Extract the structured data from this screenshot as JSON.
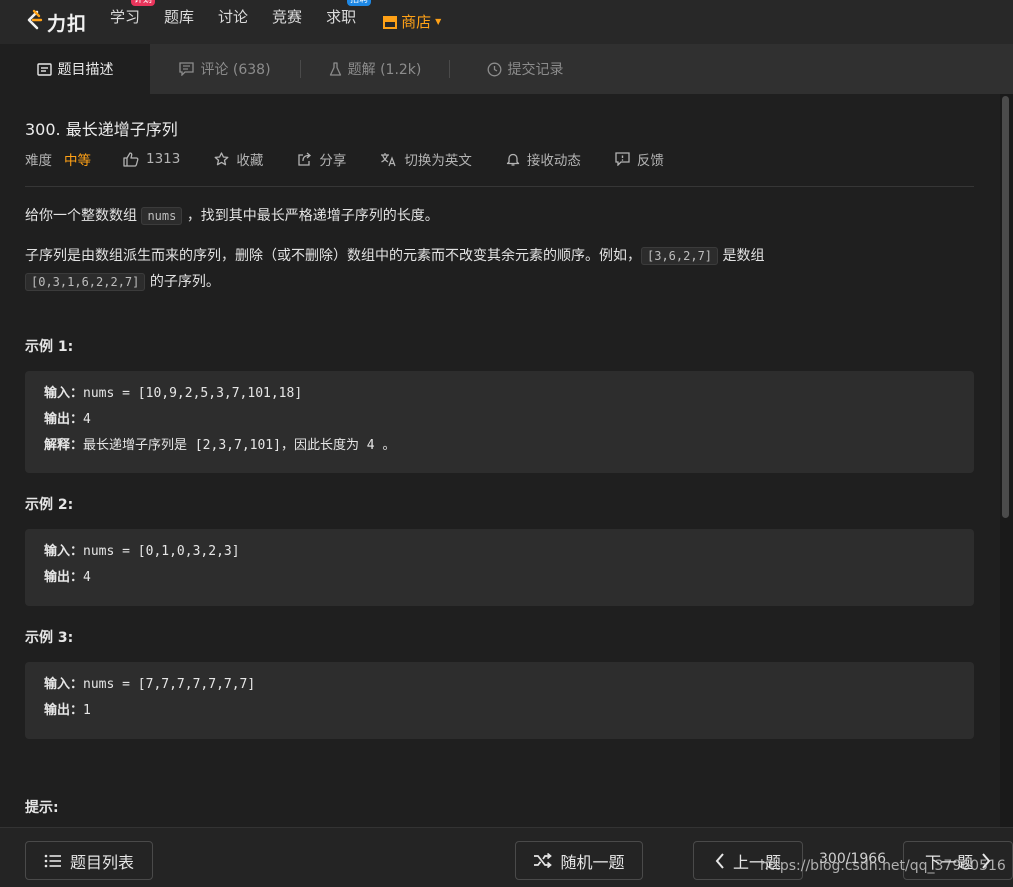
{
  "nav": {
    "logo_text": "力扣",
    "items": [
      {
        "label": "学习",
        "badge": "计划"
      },
      {
        "label": "题库"
      },
      {
        "label": "讨论"
      },
      {
        "label": "竞赛"
      },
      {
        "label": "求职",
        "badge": "招聘"
      }
    ],
    "store_label": "商店",
    "accent": "#ffa116"
  },
  "tabs": [
    {
      "label": "题目描述",
      "icon": "description-icon",
      "active": true
    },
    {
      "label": "评论 (638)",
      "icon": "comment-icon"
    },
    {
      "label": "题解 (1.2k)",
      "icon": "flask-icon"
    },
    {
      "label": "提交记录",
      "icon": "clock-icon"
    }
  ],
  "problem": {
    "title": "300. 最长递增子序列",
    "difficulty_label": "难度",
    "difficulty": "中等",
    "likes": "1313",
    "favorite": "收藏",
    "share": "分享",
    "switch_lang": "切换为英文",
    "subscribe": "接收动态",
    "feedback": "反馈",
    "desc1_a": "给你一个整数数组",
    "desc1_code": "nums",
    "desc1_b": "，找到其中最长严格递增子序列的长度。",
    "desc2_a": "子序列是由数组派生而来的序列，删除（或不删除）数组中的元素而不改变其余元素的顺序。例如，",
    "desc2_code1": "[3,6,2,7]",
    "desc2_b": "是数组",
    "desc2_code2": "[0,3,1,6,2,2,7]",
    "desc2_c": "的子序列。",
    "examples": [
      {
        "title": "示例 1:",
        "input_label": "输入：",
        "input": "nums = [10,9,2,5,3,7,101,18]",
        "output_label": "输出：",
        "output": "4",
        "explain_label": "解释：",
        "explain_a": "最长递增子序列是",
        "explain_b": "[2,3,7,101]",
        "explain_c": "，因此长度为",
        "explain_d": "4",
        "explain_e": "。"
      },
      {
        "title": "示例 2:",
        "input_label": "输入：",
        "input": "nums = [0,1,0,3,2,3]",
        "output_label": "输出：",
        "output": "4"
      },
      {
        "title": "示例 3:",
        "input_label": "输入：",
        "input": "nums = [7,7,7,7,7,7,7]",
        "output_label": "输出：",
        "output": "1"
      }
    ],
    "hints_title": "提示:"
  },
  "bottom": {
    "list_label": "题目列表",
    "random_label": "随机一题",
    "prev_label": "上一题",
    "page": "300/1966",
    "next_label": "下一题"
  },
  "watermark": "https://blog.csdn.net/qq_37960516"
}
